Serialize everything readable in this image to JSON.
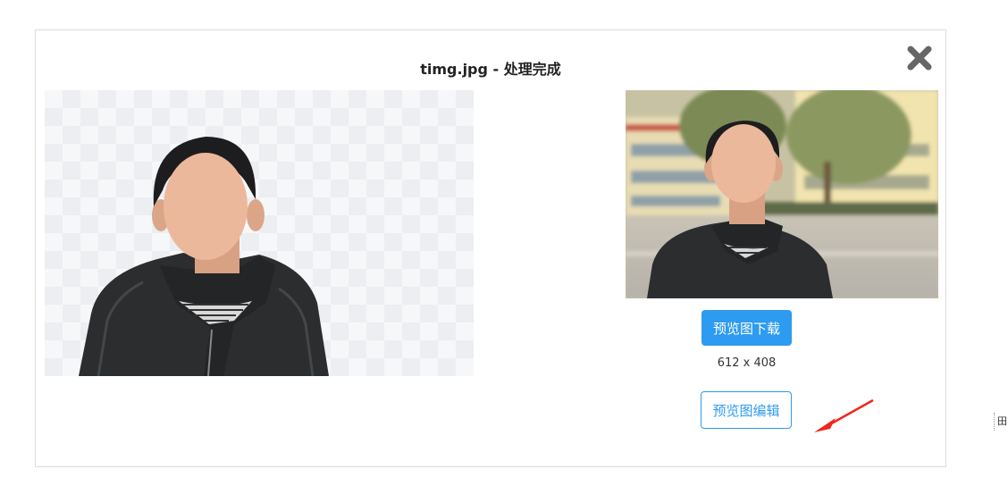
{
  "dialog": {
    "title": "timg.jpg - 处理完成",
    "close_icon": "close-x-icon"
  },
  "result_image": {
    "description_icon": "transparent-checkerboard"
  },
  "source_image": {
    "description_icon": "original-photo"
  },
  "actions": {
    "download_label": "预览图下载",
    "dimensions": "612 x 408",
    "edit_label": "预览图编辑"
  },
  "annotation": {
    "arrow_color": "#f0261e"
  },
  "colors": {
    "accent": "#2d9bf0",
    "face": "#ecb89b",
    "jacket": "#2b2d2f"
  },
  "edge_glyph": "田"
}
